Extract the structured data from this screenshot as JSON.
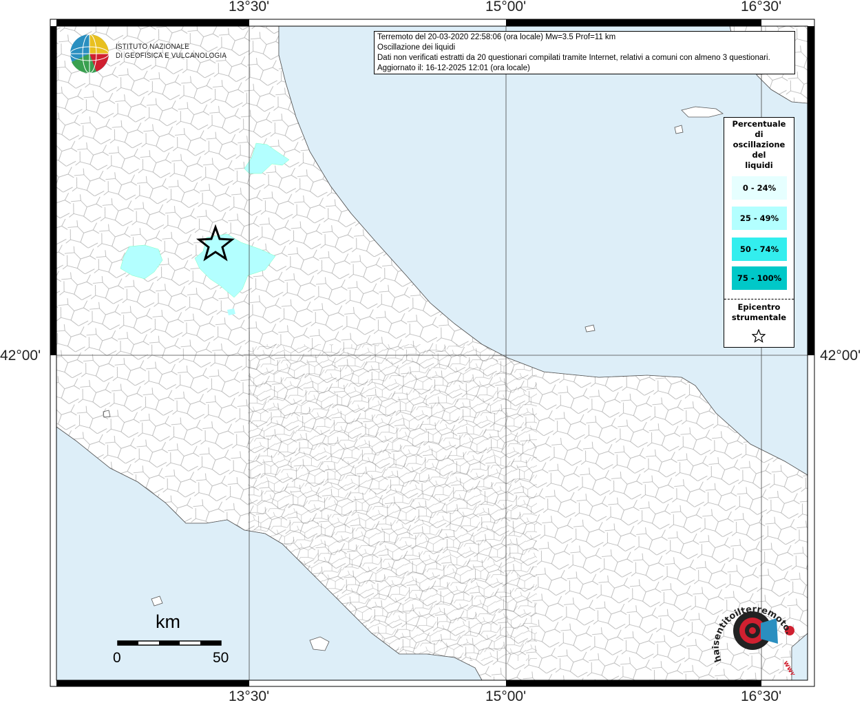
{
  "map": {
    "longitude_ticks": [
      "13°30'",
      "15°00'",
      "16°30'"
    ],
    "latitude_ticks": [
      "42°00'",
      "42°00'"
    ],
    "colors": {
      "sea": "#ddeef8",
      "land": "#ffffff",
      "border": "#9a9a9a",
      "frame": "#000000",
      "class_0_24": "#e6ffff",
      "class_25_49": "#b3ffff",
      "class_50_74": "#33eeee",
      "class_75_100": "#00c8c8"
    }
  },
  "logo": {
    "line1": "ISTITUTO NAZIONALE",
    "line2": "DI GEOFISICA E VULCANOLOGIA"
  },
  "info": {
    "line1": "Terremoto del 20-03-2020 22:58:06 (ora locale) Mw=3.5 Prof=11 km",
    "line2": "Oscillazione dei liquidi",
    "line3": "Dati non verificati estratti da 20 questionari compilati tramite Internet, relativi a comuni con almeno 3 questionari.",
    "line4": "Aggiornato il: 16-12-2025 12:01 (ora locale)"
  },
  "legend": {
    "title_l1": "Percentuale",
    "title_l2": "di",
    "title_l3": "oscillazione",
    "title_l4": "del",
    "title_l5": "liquidi",
    "classes": [
      "0 - 24%",
      "25 - 49%",
      "50 - 74%",
      "75 - 100%"
    ],
    "epicenter_l1": "Epicentro",
    "epicenter_l2": "strumentale"
  },
  "scale": {
    "unit": "km",
    "start": "0",
    "end": "50"
  },
  "stamp": {
    "text": "haisentitoilterremoto.it",
    "url_text": "www."
  }
}
